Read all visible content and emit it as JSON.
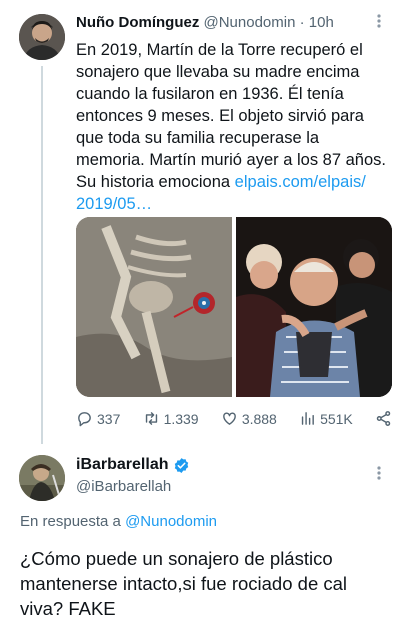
{
  "tweet": {
    "author_name": "Nuño Domínguez",
    "author_handle": "@Nunodomin",
    "time": "10h",
    "text_main": "En 2019, Martín de la Torre recuperó el sonajero que llevaba su madre encima cuando la fusilaron en 1936. Él tenía entonces 9 meses. El objeto sirvió para que toda su familia recuperase la memoria. Martín murió ayer a los 87 años. Su historia emociona ",
    "link_text": "elpais.com/elpais/ 2019/05…",
    "stats": {
      "replies": "337",
      "retweets": "1.339",
      "likes": "3.888",
      "views": "551K"
    }
  },
  "reply": {
    "author_name": "iBarbarellah",
    "author_handle": "@iBarbarellah",
    "reply_to_prefix": "En respuesta a ",
    "reply_to_handle": "@Nunodomin",
    "text": "¿Cómo puede un sonajero de plástico mantenerse intacto,si fue rociado de cal viva? FAKE"
  },
  "colors": {
    "link": "#1d9bf0",
    "verified": "#1d9bf0",
    "secondary_text": "#536471"
  },
  "icons": [
    "more-icon",
    "reply-icon",
    "retweet-icon",
    "like-icon",
    "views-icon",
    "share-icon",
    "verified-icon"
  ]
}
